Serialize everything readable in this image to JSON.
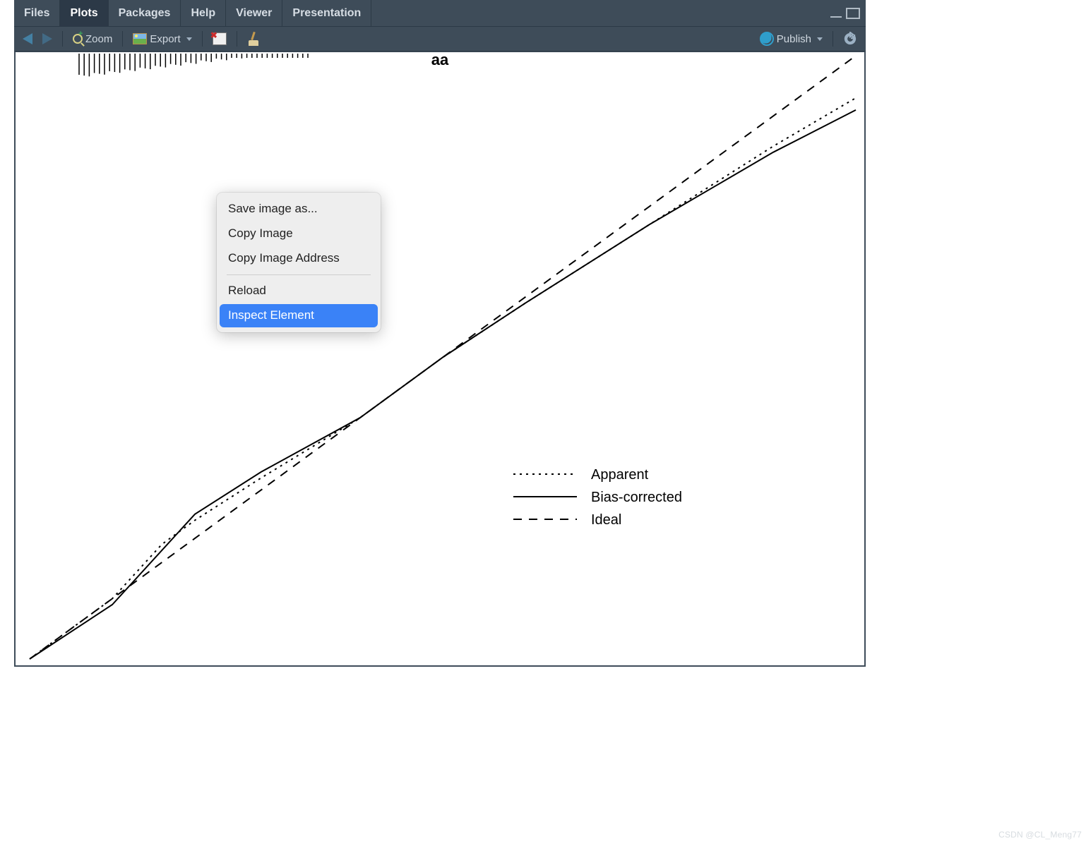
{
  "tabs": {
    "files": "Files",
    "plots": "Plots",
    "packages": "Packages",
    "help": "Help",
    "viewer": "Viewer",
    "presentation": "Presentation",
    "active": "plots"
  },
  "toolbar": {
    "zoom": "Zoom",
    "export": "Export",
    "publish": "Publish"
  },
  "context_menu": {
    "save_image_as": "Save image as...",
    "copy_image": "Copy Image",
    "copy_image_address": "Copy Image Address",
    "reload": "Reload",
    "inspect_element": "Inspect Element",
    "highlighted": "inspect_element"
  },
  "plot": {
    "title": "aa",
    "legend": {
      "apparent": "Apparent",
      "bias_corrected": "Bias-corrected",
      "ideal": "Ideal"
    }
  },
  "watermark": "CSDN @CL_Meng77",
  "chart_data": {
    "type": "line",
    "title": "aa",
    "xlabel": "",
    "ylabel": "",
    "xlim": [
      0,
      1
    ],
    "ylim": [
      0,
      1
    ],
    "legend_position": "bottom-right-inside",
    "series": [
      {
        "name": "Apparent",
        "style": "dotted",
        "x": [
          0.0,
          0.1,
          0.16,
          0.2,
          0.28,
          0.4,
          0.5,
          0.6,
          0.75,
          0.9,
          1.0
        ],
        "y": [
          0.0,
          0.1,
          0.19,
          0.23,
          0.3,
          0.4,
          0.5,
          0.59,
          0.72,
          0.85,
          0.93
        ]
      },
      {
        "name": "Bias-corrected",
        "style": "solid",
        "x": [
          0.0,
          0.1,
          0.16,
          0.2,
          0.28,
          0.4,
          0.5,
          0.6,
          0.75,
          0.9,
          1.0
        ],
        "y": [
          0.0,
          0.09,
          0.18,
          0.24,
          0.31,
          0.4,
          0.5,
          0.59,
          0.72,
          0.84,
          0.91
        ]
      },
      {
        "name": "Ideal",
        "style": "dashed",
        "x": [
          0.0,
          1.0
        ],
        "y": [
          0.0,
          1.0
        ]
      }
    ],
    "rug_marks": true
  }
}
